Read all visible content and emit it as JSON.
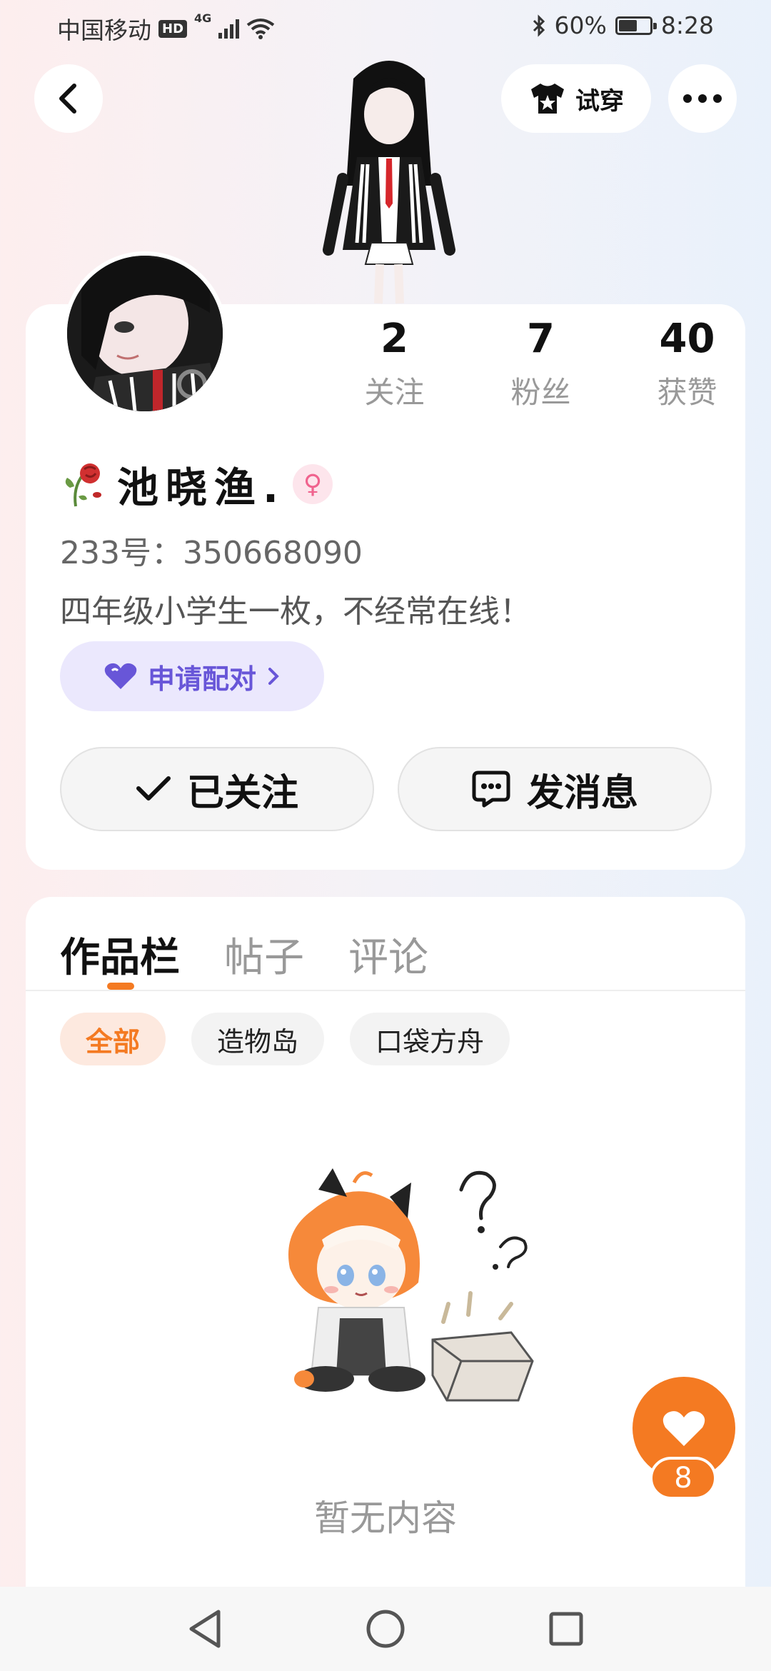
{
  "status_bar": {
    "carrier": "中国移动",
    "hd": "HD",
    "network": "4G",
    "battery": "60%",
    "battery_level": 0.6,
    "time": "8:28"
  },
  "header": {
    "tryon_label": "试穿"
  },
  "profile": {
    "stats": [
      {
        "value": "2",
        "label": "关注"
      },
      {
        "value": "7",
        "label": "粉丝"
      },
      {
        "value": "40",
        "label": "获赞"
      }
    ],
    "name": "池晓渔.",
    "uid": "233号：350668090",
    "bio": "四年级小学生一枚，不经常在线！",
    "pair_label": "申请配对",
    "follow_label": "已关注",
    "message_label": "发消息"
  },
  "content": {
    "tabs": [
      "作品栏",
      "帖子",
      "评论"
    ],
    "chips": [
      "全部",
      "造物岛",
      "口袋方舟"
    ],
    "empty_text": "暂无内容"
  },
  "like": {
    "count": "8"
  },
  "colors": {
    "accent": "#f47a22",
    "pair": "#6856d8",
    "female": "#f0638e"
  }
}
